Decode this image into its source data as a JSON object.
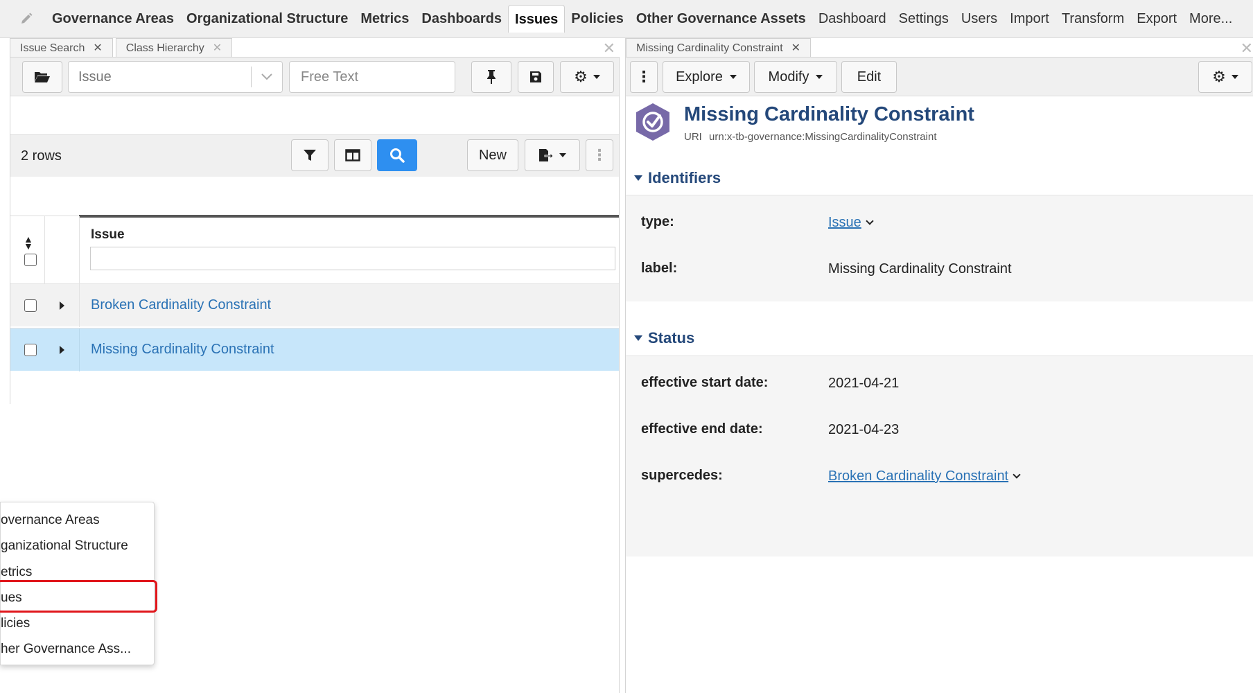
{
  "top_nav": {
    "items": [
      {
        "label": "Governance Areas",
        "bold": true
      },
      {
        "label": "Organizational Structure",
        "bold": true
      },
      {
        "label": "Metrics",
        "bold": true
      },
      {
        "label": "Dashboards",
        "bold": true
      },
      {
        "label": "Issues",
        "bold": true,
        "active": true
      },
      {
        "label": "Policies",
        "bold": true
      },
      {
        "label": "Other Governance Assets",
        "bold": true
      },
      {
        "label": "Dashboard",
        "bold": false
      },
      {
        "label": "Settings",
        "bold": false
      },
      {
        "label": "Users",
        "bold": false
      },
      {
        "label": "Import",
        "bold": false
      },
      {
        "label": "Transform",
        "bold": false
      },
      {
        "label": "Export",
        "bold": false
      },
      {
        "label": "More...",
        "bold": false
      }
    ]
  },
  "left_pane": {
    "tabs": [
      {
        "label": "Issue Search"
      },
      {
        "label": "Class Hierarchy"
      }
    ],
    "class_select": {
      "value": "Issue"
    },
    "free_text": {
      "placeholder": "Free Text"
    },
    "row_count": "2 rows",
    "new_button": "New",
    "grid": {
      "column_header": "Issue",
      "rows": [
        {
          "label": "Broken Cardinality Constraint",
          "selected": false
        },
        {
          "label": "Missing Cardinality Constraint",
          "selected": true
        }
      ]
    }
  },
  "right_pane": {
    "tab": {
      "label": "Missing Cardinality Constraint"
    },
    "toolbar": {
      "explore": "Explore",
      "modify": "Modify",
      "edit": "Edit"
    },
    "resource": {
      "title": "Missing Cardinality Constraint",
      "uri_label": "URI",
      "uri": "urn:x-tb-governance:MissingCardinalityConstraint"
    },
    "identifiers": {
      "title": "Identifiers",
      "type_label": "type:",
      "type_value": "Issue",
      "label_label": "label:",
      "label_value": "Missing Cardinality Constraint"
    },
    "status": {
      "title": "Status",
      "start_label": "effective start date:",
      "start_value": "2021-04-21",
      "end_label": "effective end date:",
      "end_value": "2021-04-23",
      "supercedes_label": "supercedes:",
      "supercedes_value": "Broken Cardinality Constraint"
    }
  },
  "dropdown_menu": {
    "items": [
      "overnance Areas",
      "ganizational Structure",
      "etrics",
      "ues",
      "licies",
      "her Governance Ass..."
    ],
    "highlighted_index": 3
  },
  "colors": {
    "link": "#2a72b5",
    "heading": "#24487a",
    "selected_row": "#c7e6fa",
    "search_button": "#2e8ff0",
    "highlight_box": "#e0161b"
  }
}
